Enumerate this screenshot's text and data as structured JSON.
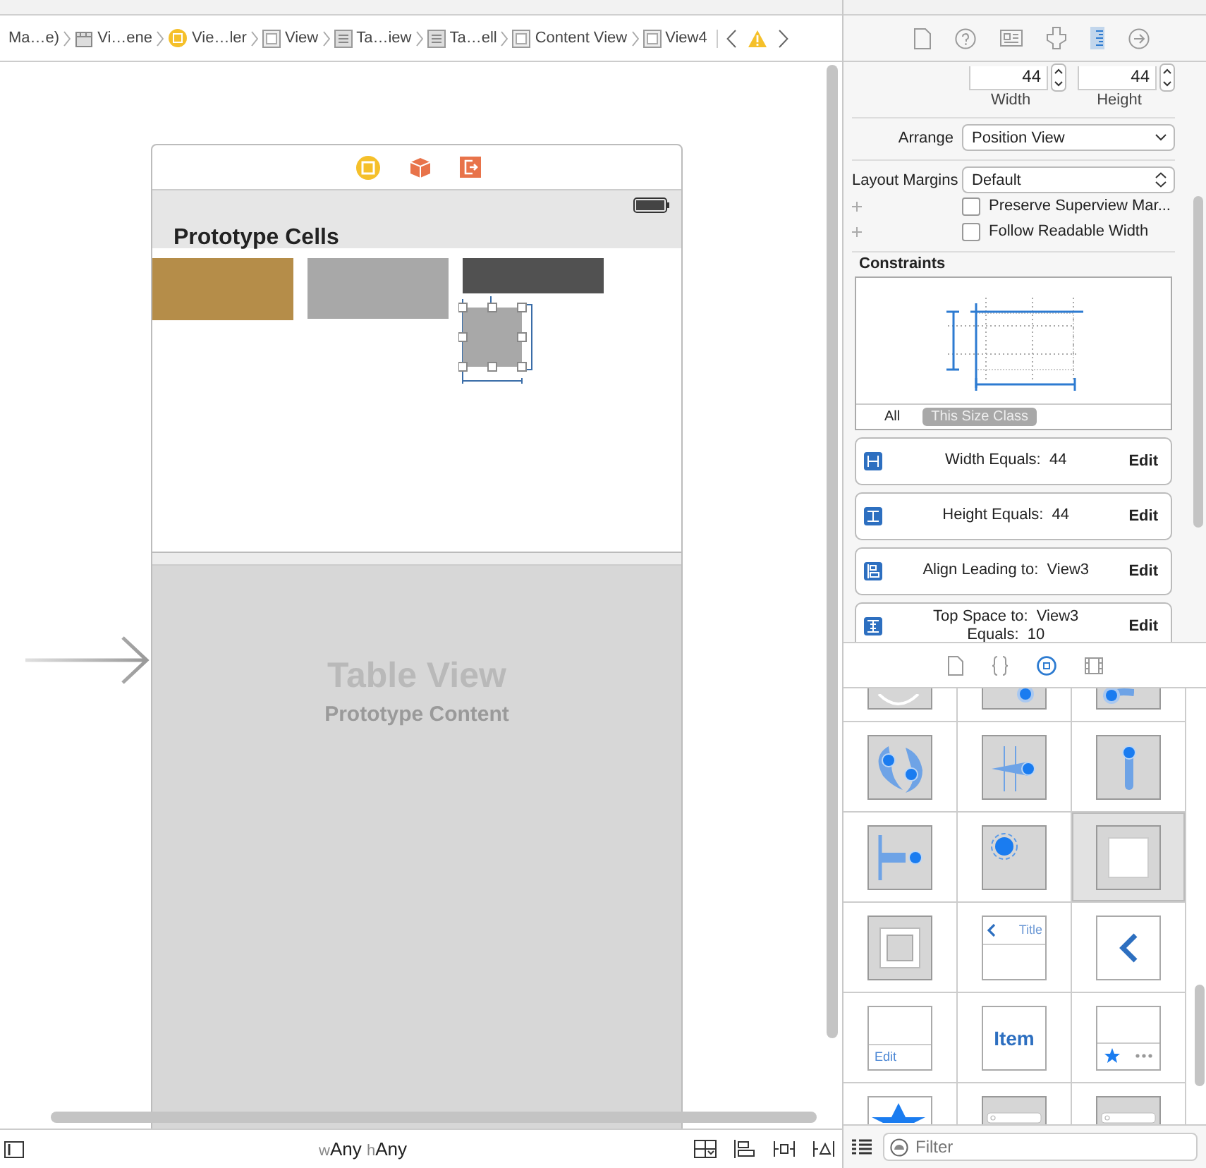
{
  "breadcrumb": [
    {
      "label": "Ma…e)",
      "kind": "none"
    },
    {
      "label": "Vi…ene",
      "kind": "scene"
    },
    {
      "label": "Vie…ler",
      "kind": "controller"
    },
    {
      "label": "View",
      "kind": "view"
    },
    {
      "label": "Ta…iew",
      "kind": "table"
    },
    {
      "label": "Ta…ell",
      "kind": "table"
    },
    {
      "label": "Content View",
      "kind": "view"
    },
    {
      "label": "View4",
      "kind": "view"
    }
  ],
  "canvas": {
    "scene_title": "Prototype Cells",
    "table_title": "Table View",
    "table_subtitle": "Prototype Content"
  },
  "size_class": {
    "w_prefix": "w",
    "w_value": "Any",
    "h_prefix": "h",
    "h_value": "Any"
  },
  "inspector_tabs": [
    {
      "kind": "file",
      "selected": false
    },
    {
      "kind": "help",
      "selected": false
    },
    {
      "kind": "identity",
      "selected": false
    },
    {
      "kind": "attributes",
      "selected": false
    },
    {
      "kind": "size",
      "selected": true
    },
    {
      "kind": "connections",
      "selected": false
    }
  ],
  "inspector": {
    "size_fields": [
      {
        "value": "44",
        "label": "Width"
      },
      {
        "value": "44",
        "label": "Height"
      }
    ],
    "arrange": {
      "label": "Arrange",
      "value": "Position View"
    },
    "layout_margins": {
      "label": "Layout Margins",
      "value": "Default"
    },
    "checkboxes": [
      {
        "label": "Preserve Superview Mar...",
        "checked": false
      },
      {
        "label": "Follow Readable Width",
        "checked": false
      }
    ],
    "constraints_title": "Constraints",
    "constraint_filters": [
      {
        "label": "All",
        "selected": false
      },
      {
        "label": "This Size Class",
        "selected": true
      }
    ],
    "constraints": [
      {
        "kind": "width",
        "lines": [
          "Width Equals:  44"
        ],
        "action": "Edit"
      },
      {
        "kind": "height",
        "lines": [
          "Height Equals:  44"
        ],
        "action": "Edit"
      },
      {
        "kind": "leading",
        "lines": [
          "Align Leading to:  View3"
        ],
        "action": "Edit"
      },
      {
        "kind": "top",
        "lines": [
          "Top Space to:  View3",
          "Equals:  10"
        ],
        "action": "Edit"
      }
    ]
  },
  "library_tabs": [
    {
      "kind": "file",
      "selected": false
    },
    {
      "kind": "braces",
      "selected": false
    },
    {
      "kind": "object",
      "selected": true
    },
    {
      "kind": "media",
      "selected": false
    }
  ],
  "library": {
    "items": [
      {
        "kind": "dial",
        "selected": false
      },
      {
        "kind": "knob-top",
        "selected": false
      },
      {
        "kind": "knob-left",
        "selected": false
      },
      {
        "kind": "rotation",
        "selected": false
      },
      {
        "kind": "swipe",
        "selected": false
      },
      {
        "kind": "pan",
        "selected": false
      },
      {
        "kind": "edge-pan",
        "selected": false
      },
      {
        "kind": "long-press",
        "selected": false
      },
      {
        "kind": "custom",
        "selected": true
      },
      {
        "kind": "container",
        "selected": false
      },
      {
        "kind": "nav-item",
        "label": "Title",
        "selected": false
      },
      {
        "kind": "back",
        "selected": false
      },
      {
        "kind": "toolbar",
        "label": "Edit",
        "selected": false
      },
      {
        "kind": "bar-item",
        "label": "Item",
        "selected": false
      },
      {
        "kind": "tab-bar",
        "selected": false
      },
      {
        "kind": "star",
        "selected": false
      },
      {
        "kind": "search",
        "selected": false
      },
      {
        "kind": "search-yellow",
        "selected": false
      }
    ],
    "filter_placeholder": "Filter"
  }
}
